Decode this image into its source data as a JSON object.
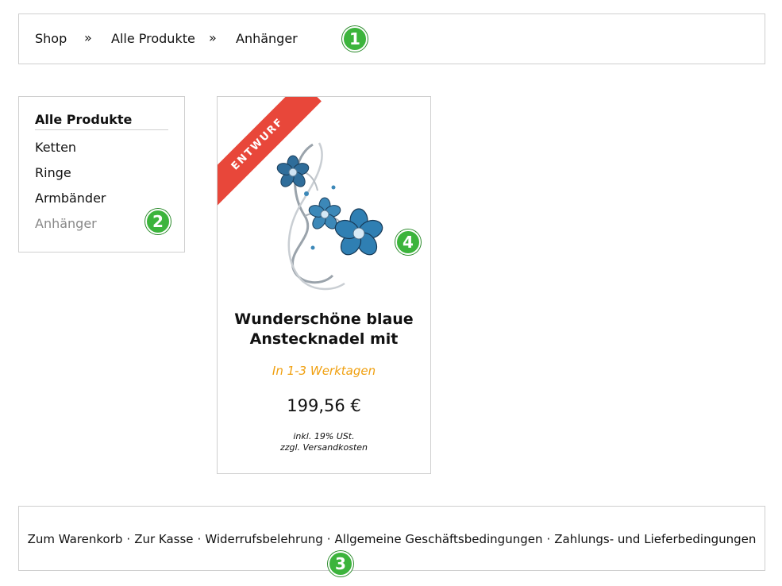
{
  "breadcrumb": {
    "items": [
      "Shop",
      "Alle Produkte",
      "Anhänger"
    ],
    "separator": "»"
  },
  "sidebar": {
    "title": "Alle Produkte",
    "items": [
      {
        "label": "Ketten",
        "active": false
      },
      {
        "label": "Ringe",
        "active": false
      },
      {
        "label": "Armbänder",
        "active": false
      },
      {
        "label": "Anhänger",
        "active": true
      }
    ]
  },
  "product": {
    "ribbon": "ENTWURF",
    "title_line1": "Wunderschöne blaue",
    "title_line2": "Anstecknadel mit",
    "delivery": "In 1-3 Werktagen",
    "price": "199,56 €",
    "tax_line1": "inkl. 19% USt.",
    "tax_line2": "zzgl. Versandkosten",
    "image_icon": "blue-flower-brooch-image"
  },
  "footer": {
    "links": [
      "Zum Warenkorb",
      "Zur Kasse",
      "Widerrufsbelehrung",
      "Allgemeine Geschäftsbedingungen",
      "Zahlungs- und Lieferbedingungen"
    ],
    "separator": "·"
  },
  "markers": [
    "1",
    "2",
    "3",
    "4"
  ],
  "colors": {
    "ribbon": "#e8473a",
    "delivery": "#f0a010",
    "marker": "#3cb43c",
    "border": "#cfcfcf",
    "active_item": "#888888"
  }
}
